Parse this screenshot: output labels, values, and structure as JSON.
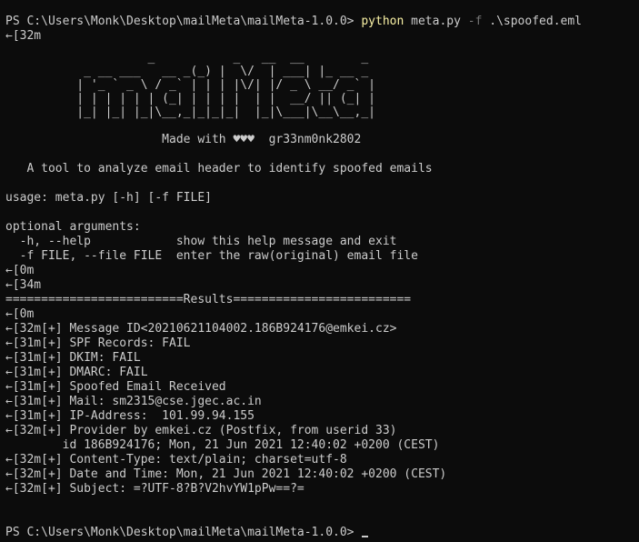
{
  "prompt": {
    "path": "PS C:\\Users\\Monk\\Desktop\\mailMeta\\mailMeta-1.0.0>",
    "command": "python",
    "args_plain": " meta.py ",
    "flag": "-f",
    "arg_file": " .\\spoofed.eml"
  },
  "escape_line_1": "←[32m",
  "ascii_art": [
    "                    _           _   __  __        _              ",
    "           _ __ ___   __ _(_) |  \\/  | ___| |_ __ _ ",
    "          | '_ ` _ \\ / _` | | | |\\/| |/ _ \\ __/ _` |",
    "          | | | | | | (_| | | | |  | |  __/ || (_| |",
    "          |_| |_| |_|\\__,_|_|_|_|  |_|\\___|\\__\\__,_|"
  ],
  "made_with": "                      Made with ♥♥♥  gr33nm0nk2802",
  "tagline": "   A tool to analyze email header to identify spoofed emails",
  "usage": "usage: meta.py [-h] [-f FILE]",
  "optional_header": "optional arguments:",
  "opt_help": "  -h, --help            show this help message and exit",
  "opt_file": "  -f FILE, --file FILE  enter the raw(original) email file",
  "escape_0m_a": "←[0m",
  "escape_34m": "←[34m",
  "results_bar": "=========================Results=========================",
  "escape_0m_b": "←[0m",
  "results": [
    "←[32m[+] Message ID<20210621104002.186B924176@emkei.cz>",
    "←[31m[+] SPF Records: FAIL",
    "←[31m[+] DKIM: FAIL",
    "←[31m[+] DMARC: FAIL",
    "←[31m[+] Spoofed Email Received",
    "←[31m[+] Mail: sm2315@cse.jgec.ac.in",
    "←[31m[+] IP-Address:  101.99.94.155",
    "←[32m[+] Provider by emkei.cz (Postfix, from userid 33)",
    "        id 186B924176; Mon, 21 Jun 2021 12:40:02 +0200 (CEST)",
    "←[32m[+] Content-Type: text/plain; charset=utf-8",
    "←[32m[+] Date and Time: Mon, 21 Jun 2021 12:40:02 +0200 (CEST)",
    "←[32m[+] Subject: =?UTF-8?B?V2hvYW1pPw==?="
  ],
  "final_prompt": "PS C:\\Users\\Monk\\Desktop\\mailMeta\\mailMeta-1.0.0>"
}
